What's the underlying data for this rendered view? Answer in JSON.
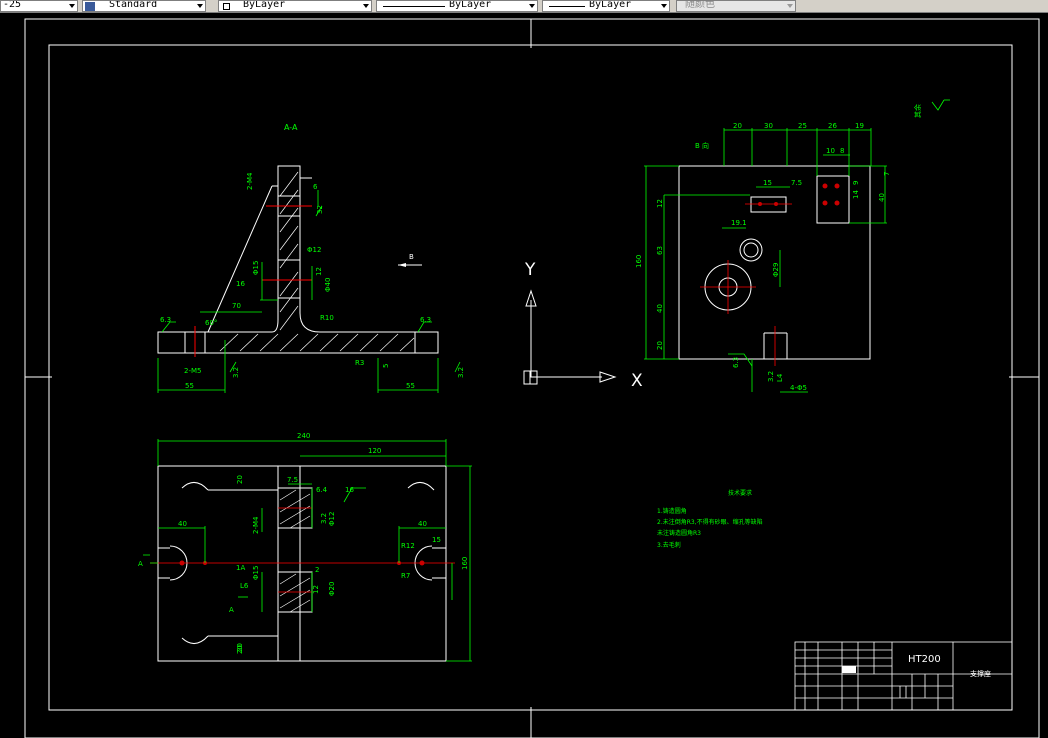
{
  "toolbar": {
    "dimstyle_value": "-25",
    "textstyle_value": "Standard",
    "layer_value": "ByLayer",
    "linetype_value": "ByLayer",
    "lineweight_value": "ByLayer",
    "plotstyle_value": "随颜色"
  },
  "drawing": {
    "section_label": "A-A",
    "view_b_label": "B 向",
    "view_b_arrow": "B",
    "roughness_symbol": "其余",
    "section_marks": [
      "A",
      "A"
    ],
    "material": "HT200",
    "part_name": "支撑座",
    "notes": {
      "title": "技术要求",
      "items": [
        "1.铸造圆角",
        "2.未注倒角R3,不得有砂眼、缩孔等缺陷",
        "未注铸造圆角R3",
        "3.去毛刺"
      ]
    },
    "ucs_labels": {
      "x": "X",
      "y": "Y"
    },
    "dims_section": [
      "2-M4",
      "Φ15",
      "16",
      "70",
      "6",
      "32",
      "12",
      "Φ40",
      "R10",
      "6.3",
      "60°",
      "6.3",
      "2-M5",
      "3.2",
      "R3",
      "5",
      "55",
      "55",
      "3.2",
      "Φ12"
    ],
    "dims_viewb": [
      "20",
      "30",
      "25",
      "26",
      "19",
      "10",
      "8",
      "15",
      "7.5",
      "14",
      "9",
      "7",
      "40",
      "12",
      "63",
      "160",
      "40",
      "20",
      "19.1",
      "Φ29",
      "6.3",
      "3.2",
      "4-Φ5",
      "L4"
    ],
    "dims_plan": [
      "240",
      "20",
      "120",
      "20",
      "7.5",
      "6.4",
      "16",
      "40",
      "2-M4",
      "3.2",
      "Φ12",
      "40",
      "R12",
      "15",
      "A",
      "1A",
      "Φ15",
      "2",
      "R7",
      "L6",
      "12",
      "Φ20",
      "A",
      "160",
      "20"
    ]
  }
}
